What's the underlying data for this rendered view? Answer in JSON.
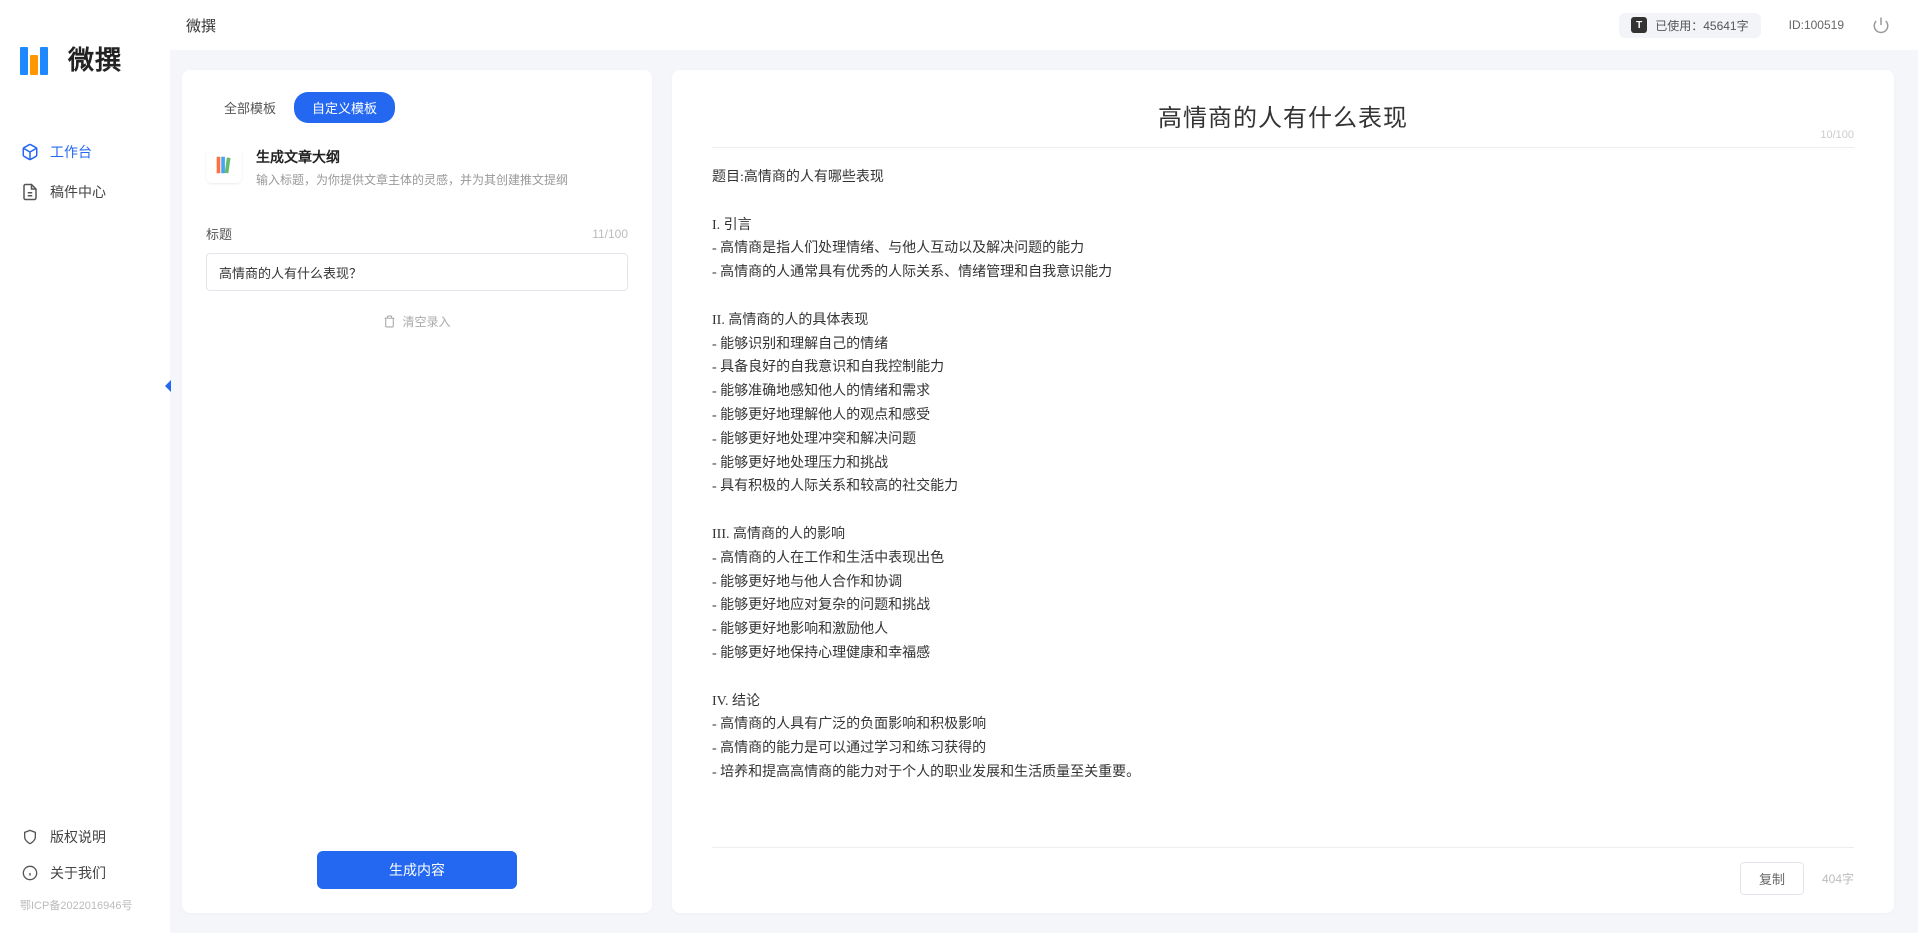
{
  "app_name": "微撰",
  "header": {
    "title": "微撰",
    "usage_label": "已使用：45641字",
    "id_label": "ID:100519"
  },
  "sidebar": {
    "nav": [
      {
        "label": "工作台",
        "icon": "cube"
      },
      {
        "label": "稿件中心",
        "icon": "document"
      }
    ],
    "bottom": [
      {
        "label": "版权说明",
        "icon": "shield"
      },
      {
        "label": "关于我们",
        "icon": "info"
      }
    ],
    "icp": "鄂ICP备2022016946号"
  },
  "left": {
    "tabs": [
      {
        "label": "全部模板",
        "active": false
      },
      {
        "label": "自定义模板",
        "active": true
      }
    ],
    "template": {
      "title": "生成文章大纲",
      "description": "输入标题，为你提供文章主体的灵感，并为其创建推文提纲"
    },
    "field": {
      "label": "标题",
      "char_count": "11/100",
      "value": "高情商的人有什么表现？"
    },
    "clear_label": "清空录入",
    "generate_label": "生成内容"
  },
  "right": {
    "title": "高情商的人有什么表现",
    "title_count": "10/100",
    "body": "题目:高情商的人有哪些表现\n\nI. 引言\n- 高情商是指人们处理情绪、与他人互动以及解决问题的能力\n- 高情商的人通常具有优秀的人际关系、情绪管理和自我意识能力\n\nII. 高情商的人的具体表现\n- 能够识别和理解自己的情绪\n- 具备良好的自我意识和自我控制能力\n- 能够准确地感知他人的情绪和需求\n- 能够更好地理解他人的观点和感受\n- 能够更好地处理冲突和解决问题\n- 能够更好地处理压力和挑战\n- 具有积极的人际关系和较高的社交能力\n\nIII. 高情商的人的影响\n- 高情商的人在工作和生活中表现出色\n- 能够更好地与他人合作和协调\n- 能够更好地应对复杂的问题和挑战\n- 能够更好地影响和激励他人\n- 能够更好地保持心理健康和幸福感\n\nIV. 结论\n- 高情商的人具有广泛的负面影响和积极影响\n- 高情商的能力是可以通过学习和练习获得的\n- 培养和提高高情商的能力对于个人的职业发展和生活质量至关重要。",
    "copy_label": "复制",
    "word_count": "404字"
  }
}
